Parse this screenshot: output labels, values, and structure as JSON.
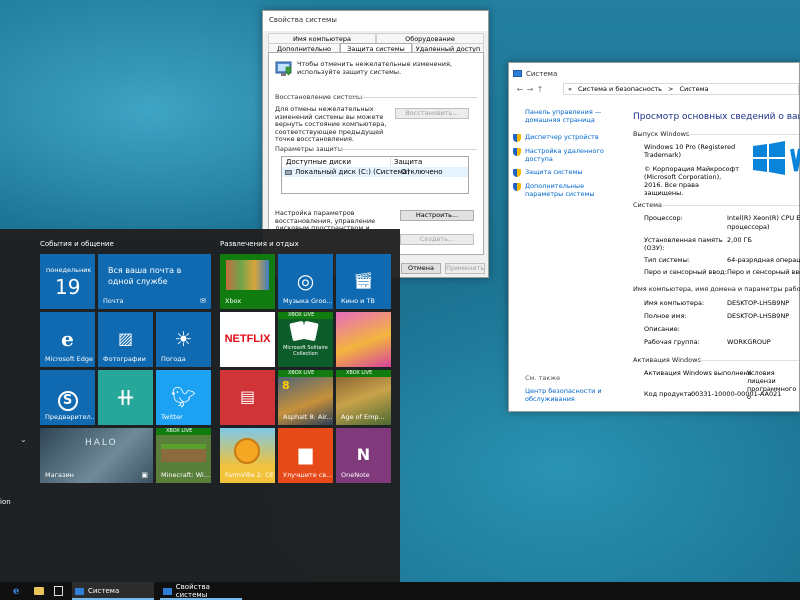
{
  "sysprops": {
    "title": "Свойства системы",
    "tabs_row1": [
      "Имя компьютера",
      "Оборудование"
    ],
    "tabs_row2": [
      "Дополнительно",
      "Защита системы",
      "Удаленный доступ"
    ],
    "intro": "Чтобы отменить нежелательные изменения, используйте защиту системы.",
    "restore_group": "Восстановление системы",
    "restore_text": "Для отмены нежелательных изменений системы вы можете вернуть состояние компьютера, соответствующее предыдущей точке восстановления.",
    "restore_button": "Восстановить...",
    "protect_group": "Параметры защиты",
    "col_disks": "Доступные диски",
    "col_protection": "Защита",
    "disk_name": "Локальный диск (C:) (Система)",
    "disk_status": "Отключено",
    "config_text": "Настройка параметров восстановления, управление дисковым пространством и удаление точек восстановления.",
    "config_button": "Настроить...",
    "create_text": "Немедленно создать точку восстановления для дисков с включенной защитой системы.",
    "create_button": "Создать...",
    "ok_button": "ОК",
    "cancel_button": "Отмена",
    "apply_button": "Применить"
  },
  "system": {
    "title": "Система",
    "breadcrumb": [
      "«",
      "Система и безопасность",
      ">",
      "Система"
    ],
    "heading": "Просмотр основных сведений о вашем ко",
    "sidebar_home": "Панель управления — домашняя страница",
    "sidebar_links": [
      "Диспетчер устройств",
      "Настройка удаленного доступа",
      "Защита системы",
      "Дополнительные параметры системы"
    ],
    "see_also": "См. также",
    "see_also_link": "Центр безопасности и обслуживания",
    "edition_header": "Выпуск Windows",
    "edition_name": "Windows 10 Pro (Registered Trademark)",
    "copyright": "© Корпорация Майкрософт (Microsoft Corporation), 2016. Все права защищены.",
    "system_header": "Система",
    "processor_label": "Процессор:",
    "processor_value": "Intel(R) Xeon(R) CPU E3-1",
    "processor_value2": "процессора)",
    "ram_label": "Установленная память (ОЗУ):",
    "ram_value": "2,00 ГБ",
    "systype_label": "Тип системы:",
    "systype_value": "64-разрядная операцион",
    "pen_label": "Перо и сенсорный ввод:",
    "pen_value": "Перо и сенсорный ввод н",
    "name_header": "Имя компьютера, имя домена и параметры рабочей гр",
    "computer_label": "Имя компьютера:",
    "computer_value": "DESKTOP-LH5B9NP",
    "fullname_label": "Полное имя:",
    "fullname_value": "DESKTOP-LH5B9NP",
    "desc_label": "Описание:",
    "desc_value": "",
    "workgroup_label": "Рабочая группа:",
    "workgroup_value": "WORKGROUP",
    "activation_header": "Активация Windows",
    "activation_text": "Активация Windows выполнена",
    "license_link": "Условия лицензи программного о",
    "product_label": "Код продукта:",
    "product_value": "00331-10000-00001-AA021"
  },
  "start": {
    "group1": "События и общение",
    "group2": "Развлечения и отдых",
    "calendar_day": "понедельник",
    "calendar_date": "19",
    "mail_text": "Вся ваша почта в одной службе",
    "tiles": {
      "mail": "Почта",
      "edge": "Microsoft Edge",
      "photos": "Фотографии",
      "weather": "Погода",
      "skype": "Предварител...",
      "tunein": "",
      "twitter": "Twitter",
      "store": "Магазин",
      "minecraft": "Minecraft: Wi...",
      "xbox": "Xbox",
      "groove": "Музыка Groo...",
      "movies": "Кино и ТВ",
      "netflix": "NETFLIX",
      "solitaire": "Microsoft Solitaire Collection",
      "candy": "",
      "news": "",
      "asphalt": "Asphalt 8: Air...",
      "aoe": "Age of Emp...",
      "farmville": "FarmVille 2: CE",
      "office": "Улучшите св...",
      "onenote": "OneNote",
      "xbox_live": "XBOX LIVE",
      "halo": "HALO"
    },
    "left_text": "ion"
  },
  "taskbar": {
    "system_label": "Система",
    "sysprops_label": "Свойства системы"
  },
  "colors": {
    "tile_blue": "#0f6ab2",
    "tile_teal": "#27a69a",
    "tile_red": "#d13438",
    "accent": "#0078d7"
  }
}
